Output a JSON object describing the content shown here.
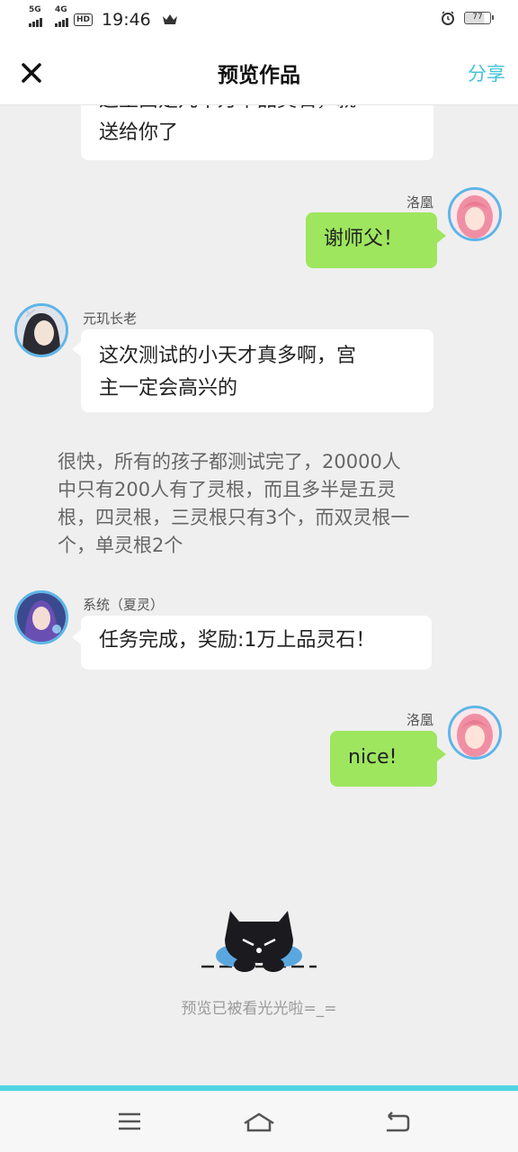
{
  "status_bar": {
    "net1": "5G",
    "net2": "4G",
    "hd": "HD",
    "time": "19:46",
    "battery": "77"
  },
  "header": {
    "title": "预览作品",
    "share_label": "分享"
  },
  "messages": [
    {
      "side": "left",
      "text_lines": [
        "这里面是几十万下品灵石，就",
        "送给你了"
      ]
    },
    {
      "side": "right",
      "name": "洛凰",
      "text": "谢师父！"
    },
    {
      "side": "left",
      "name": "元玑长老",
      "text_lines": [
        "这次测试的小天才真多啊，宫",
        "主一定会高兴的"
      ]
    },
    {
      "type": "narration",
      "lines": [
        "很快，所有的孩子都测试完了，20000人",
        "中只有200人有了灵根，而且多半是五灵",
        "根，四灵根，三灵根只有3个，而双灵根一",
        "个，单灵根2个"
      ]
    },
    {
      "side": "left",
      "name": "系统（夏灵）",
      "text": "任务完成，奖励:1万上品灵石！"
    },
    {
      "side": "right",
      "name": "洛凰",
      "text": "nice!"
    }
  ],
  "footer": {
    "empty_text": "预览已被看光光啦=_="
  },
  "colors": {
    "accent": "#43c2d8",
    "bubble_green": "#9ee65e",
    "avatar_border": "#5db6e8"
  }
}
